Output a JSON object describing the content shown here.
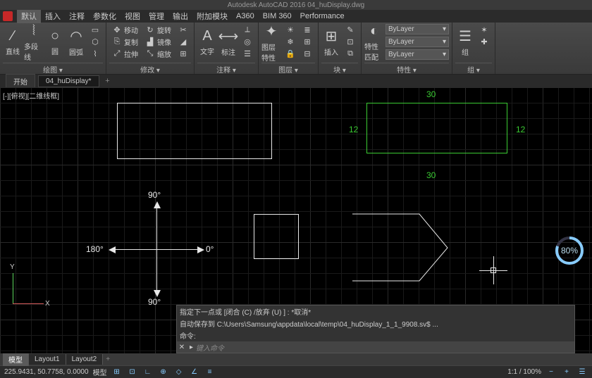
{
  "title": "Autodesk AutoCAD 2016   04_huDisplay.dwg",
  "menus": {
    "active": "默认",
    "items": [
      "默认",
      "插入",
      "注释",
      "参数化",
      "视图",
      "管理",
      "输出",
      "附加模块",
      "A360",
      "BIM 360",
      "Performance"
    ]
  },
  "ribbon": {
    "panels": [
      {
        "title": "绘图 ▾",
        "large": [
          {
            "label": "直线",
            "icon": "∕"
          },
          {
            "label": "多段线",
            "icon": "⦚"
          },
          {
            "label": "圆",
            "icon": "○"
          },
          {
            "label": "圆弧",
            "icon": "◠"
          }
        ],
        "small_cols": [
          [
            {
              "icon": "▭",
              "label": ""
            },
            {
              "icon": "⬡",
              "label": ""
            },
            {
              "icon": "⌇",
              "label": ""
            }
          ]
        ]
      },
      {
        "title": "修改 ▾",
        "small_cols": [
          [
            {
              "icon": "✥",
              "label": "移动"
            },
            {
              "icon": "⎘",
              "label": "复制"
            },
            {
              "icon": "⤢",
              "label": "拉伸"
            }
          ],
          [
            {
              "icon": "↻",
              "label": "旋转"
            },
            {
              "icon": "▟",
              "label": "镜像"
            },
            {
              "icon": "⤡",
              "label": "缩放"
            }
          ],
          [
            {
              "icon": "✂",
              "label": "-/-"
            },
            {
              "icon": "◢",
              "label": ""
            },
            {
              "icon": "⊞",
              "label": ""
            }
          ]
        ]
      },
      {
        "title": "注释 ▾",
        "large": [
          {
            "label": "文字",
            "icon": "A"
          },
          {
            "label": "标注",
            "icon": "⟷"
          }
        ],
        "small_cols": [
          [
            {
              "icon": "⟂",
              "label": ""
            },
            {
              "icon": "◎",
              "label": ""
            },
            {
              "icon": "☰",
              "label": ""
            }
          ]
        ]
      },
      {
        "title": "图层 ▾",
        "large": [
          {
            "label": "图层特性",
            "icon": "✦"
          }
        ],
        "small_cols": [
          [
            {
              "icon": "☀",
              "label": ""
            },
            {
              "icon": "❄",
              "label": ""
            },
            {
              "icon": "🔒",
              "label": ""
            }
          ],
          [
            {
              "icon": "≣",
              "label": ""
            },
            {
              "icon": "⊞",
              "label": ""
            },
            {
              "icon": "⊟",
              "label": ""
            }
          ]
        ]
      },
      {
        "title": "块 ▾",
        "large": [
          {
            "label": "插入",
            "icon": "⊞"
          }
        ],
        "small_cols": [
          [
            {
              "icon": "✎",
              "label": ""
            },
            {
              "icon": "⊡",
              "label": ""
            },
            {
              "icon": "⧉",
              "label": ""
            }
          ]
        ]
      },
      {
        "title": "特性 ▾",
        "large": [
          {
            "label": "特性匹配",
            "icon": "◐"
          }
        ],
        "dropdowns": [
          "ByLayer",
          "ByLayer",
          "ByLayer"
        ]
      },
      {
        "title": "组 ▾",
        "large": [
          {
            "label": "组",
            "icon": "☰"
          }
        ],
        "small_cols": [
          [
            {
              "icon": "✶",
              "label": ""
            },
            {
              "icon": "✚",
              "label": ""
            }
          ]
        ]
      }
    ]
  },
  "doc_tabs": {
    "items": [
      {
        "label": "开始",
        "active": false
      },
      {
        "label": "04_huDisplay*",
        "active": true
      }
    ]
  },
  "viewport_label": "[-][俯视][二维线框]",
  "dimensions": {
    "top": "30",
    "bottom": "30",
    "left": "12",
    "right": "12"
  },
  "compass": {
    "up": "90°",
    "down": "90°",
    "left": "180°",
    "right": "0°"
  },
  "ucs": {
    "x": "X",
    "y": "Y"
  },
  "progress_pct": "80%",
  "command": {
    "hist1": "指定下一点或  [闭合 (C) /放弃 (U) ] :  *取消*",
    "hist2": "自动保存到  C:\\Users\\Samsung\\appdata\\local\\temp\\04_huDisplay_1_1_9908.sv$ ...",
    "hist3": "命令:",
    "prompt": "▸",
    "placeholder": "键入命令"
  },
  "layout_tabs": {
    "items": [
      {
        "label": "模型",
        "active": true
      },
      {
        "label": "Layout1",
        "active": false
      },
      {
        "label": "Layout2",
        "active": false
      }
    ]
  },
  "status": {
    "coords": "225.9431, 50.7758, 0.0000",
    "space": "模型",
    "zoom": "1:1 / 100%"
  }
}
